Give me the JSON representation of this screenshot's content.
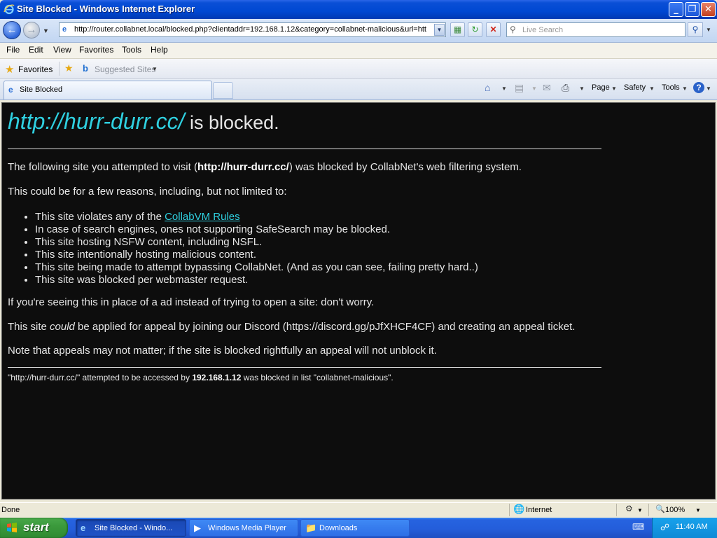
{
  "window": {
    "title": "Site Blocked - Windows Internet Explorer",
    "minimize": "_",
    "restore": "❐",
    "close": "✕"
  },
  "address_bar": {
    "url": "http://router.collabnet.local/blocked.php?clientaddr=192.168.1.12&category=collabnet-malicious&url=htt",
    "search_placeholder": "Live Search"
  },
  "menu": {
    "items": [
      "File",
      "Edit",
      "View",
      "Favorites",
      "Tools",
      "Help"
    ]
  },
  "favorites_bar": {
    "favorites_label": "Favorites",
    "suggested_sites_label": "Suggested Sites"
  },
  "tabs": {
    "active_tab_label": "Site Blocked"
  },
  "command_bar": {
    "page_label": "Page",
    "safety_label": "Safety",
    "tools_label": "Tools"
  },
  "page": {
    "heading_url": "http://hurr-durr.cc/",
    "heading_suffix": " is blocked.",
    "intro_prefix": "The following site you attempted to visit (",
    "intro_site": "http://hurr-durr.cc/",
    "intro_suffix": ") was blocked by CollabNet's web filtering system.",
    "reasons_intro": "This could be for a few reasons, including, but not limited to:",
    "reason_1_prefix": "This site violates any of the ",
    "reason_1_link": "CollabVM Rules",
    "reasons": [
      "In case of search engines, ones not supporting SafeSearch may be blocked.",
      "This site hosting NSFW content, including NSFL.",
      "This site intentionally hosting malicious content.",
      "This site being made to attempt bypassing CollabNet. (And as you can see, failing pretty hard..)",
      "This site was blocked per webmaster request."
    ],
    "ad_note": "If you're seeing this in place of a ad instead of trying to open a site: don't worry.",
    "appeal_prefix": "This site ",
    "appeal_emphasis": "could",
    "appeal_suffix": " be applied for appeal by joining our Discord (https://discord.gg/pJfXHCF4CF) and creating an appeal ticket.",
    "appeal_note": "Note that appeals may not matter; if the site is blocked rightfully an appeal will not unblock it.",
    "footer_prefix": "\"http://hurr-durr.cc/\" attempted to be accessed by ",
    "footer_ip": "192.168.1.12",
    "footer_suffix": " was blocked in list \"collabnet-malicious\"."
  },
  "status_bar": {
    "status": "Done",
    "zone": "Internet",
    "zoom": "100%"
  },
  "taskbar": {
    "start_label": "start",
    "ie_task": "Site Blocked - Windo...",
    "wmp_task": "Windows Media Player",
    "downloads_task": "Downloads",
    "clock": "11:40 AM"
  },
  "colors": {
    "page_background": "#0d0d0d",
    "link_cyan": "#2fd0e0",
    "taskbar_blue": "#245edb",
    "start_green": "#3b9a3c"
  },
  "icons": [
    "ie-icon",
    "back-icon",
    "forward-icon",
    "refresh-icon",
    "stop-icon",
    "search-icon",
    "star-icon",
    "home-icon",
    "feeds-icon",
    "mail-icon",
    "print-icon",
    "help-icon",
    "globe-icon",
    "windows-flag-icon"
  ]
}
